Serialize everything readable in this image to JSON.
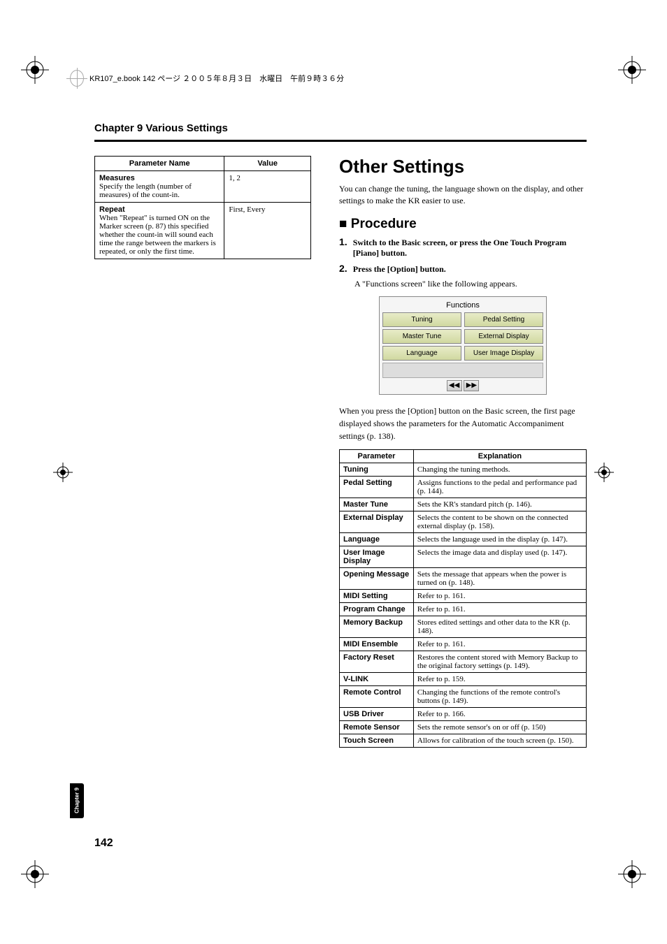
{
  "header_text": "KR107_e.book 142 ページ ２００５年８月３日　水曜日　午前９時３６分",
  "chapter_title": "Chapter 9 Various Settings",
  "left_table": {
    "headers": [
      "Parameter Name",
      "Value"
    ],
    "rows": [
      {
        "name_bold": "Measures",
        "name_desc": "Specify the length (number of measures) of the count-in.",
        "value": "1, 2"
      },
      {
        "name_bold": "Repeat",
        "name_desc": "When \"Repeat\" is turned ON on the Marker screen (p. 87) this specified whether the count-in will sound each time the range between the markers is repeated, or only the first time.",
        "value": "First, Every"
      }
    ]
  },
  "section_title": "Other Settings",
  "intro": "You can change the tuning, the language shown on the display, and other settings to make the KR easier to use.",
  "procedure_title": "Procedure",
  "steps": [
    {
      "num": "1.",
      "text": "Switch to the Basic screen, or press the One Touch Program [Piano] button."
    },
    {
      "num": "2.",
      "text": "Press the [Option] button."
    }
  ],
  "step2_sub": "A \"Functions screen\" like the following appears.",
  "functions_box": {
    "title": "Functions",
    "cells": [
      [
        "Tuning",
        "Pedal Setting"
      ],
      [
        "Master Tune",
        "External Display"
      ],
      [
        "Language",
        "User Image Display"
      ]
    ],
    "nav_left": "◀◀",
    "nav_right": "▶▶"
  },
  "after_box": "When you press the [Option] button on the Basic screen, the first page displayed shows the parameters for the Automatic Accompaniment settings (p. 138).",
  "expl_table": {
    "headers": [
      "Parameter",
      "Explanation"
    ],
    "rows": [
      {
        "p": "Tuning",
        "e": "Changing the tuning methods."
      },
      {
        "p": "Pedal Setting",
        "e": "Assigns functions to the pedal and performance pad (p. 144)."
      },
      {
        "p": "Master Tune",
        "e": "Sets the KR's standard pitch (p. 146)."
      },
      {
        "p": "External Display",
        "e": "Selects the content to be shown on the connected external display (p. 158)."
      },
      {
        "p": "Language",
        "e": "Selects the language used in the display (p. 147)."
      },
      {
        "p": "User Image Display",
        "e": "Selects the image data and display used (p. 147)."
      },
      {
        "p": "Opening Message",
        "e": "Sets the message that appears when the power is turned on (p. 148)."
      },
      {
        "p": "MIDI Setting",
        "e": "Refer to p. 161."
      },
      {
        "p": "Program Change",
        "e": "Refer to p. 161."
      },
      {
        "p": "Memory Backup",
        "e": "Stores edited settings and other data to the KR (p. 148)."
      },
      {
        "p": "MIDI Ensemble",
        "e": "Refer to p. 161."
      },
      {
        "p": "Factory Reset",
        "e": "Restores the content stored with Memory Backup to the original factory settings (p. 149)."
      },
      {
        "p": "V-LINK",
        "e": "Refer to p. 159."
      },
      {
        "p": "Remote Control",
        "e": "Changing the functions of the remote control's buttons (p. 149)."
      },
      {
        "p": "USB Driver",
        "e": "Refer to p. 166."
      },
      {
        "p": "Remote Sensor",
        "e": "Sets the remote sensor's on or off (p. 150)"
      },
      {
        "p": "Touch Screen",
        "e": "Allows for calibration of the touch screen (p. 150)."
      }
    ]
  },
  "side_tab": "Chapter 9",
  "page_number": "142"
}
